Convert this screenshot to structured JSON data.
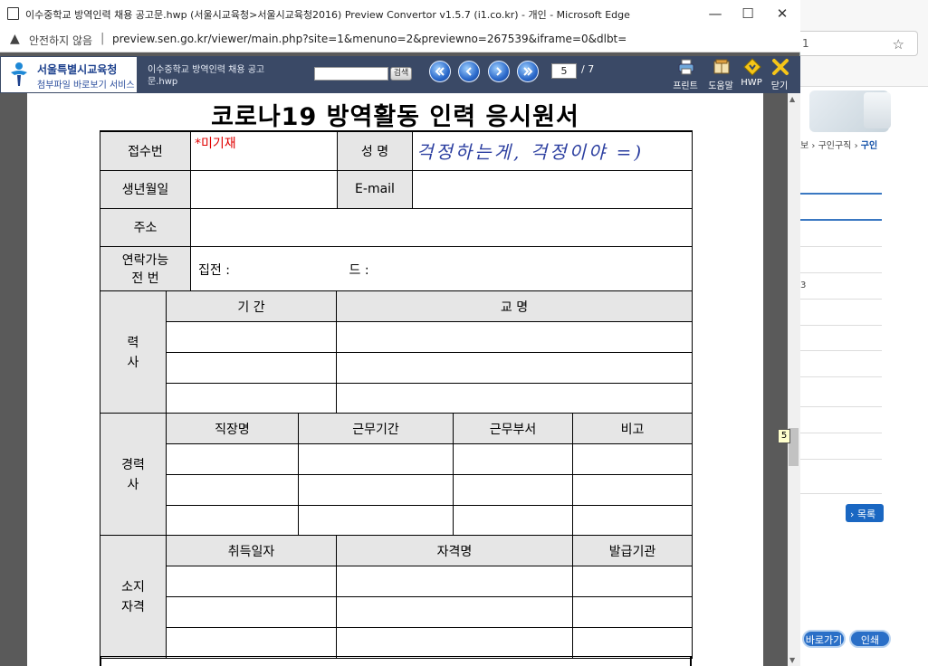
{
  "window": {
    "title": "이수중학교 방역인력 채용 공고문.hwp (서울시교육청>서울시교육청2016) Preview Convertor v1.5.7 (i1.co.kr) - 개인 - Microsoft Edge",
    "minimize": "—",
    "maximize": "☐",
    "close": "✕"
  },
  "address_bar": {
    "security_text": "안전하지 않음",
    "separator": "|",
    "url": "preview.sen.go.kr/viewer/main.php?site=1&menuno=2&previewno=267539&iframe=0&dlbt="
  },
  "viewer_toolbar": {
    "org_name": "서울특별시교육청",
    "org_sub": "첨부파일 바로보기 서비스",
    "doc_title": "이수중학교 방역인력 채용 공고문.hwp",
    "search_placeholder": "",
    "search_label": "검색",
    "current_page": "5",
    "total_pages": "/ 7",
    "tools": [
      {
        "label": "프린트",
        "icon": "printer-icon"
      },
      {
        "label": "도움말",
        "icon": "help-book-icon"
      },
      {
        "label": "HWP",
        "icon": "hwp-download-icon"
      },
      {
        "label": "닫기",
        "icon": "close-x-icon"
      }
    ],
    "accent_color": "#3a4966"
  },
  "page_tooltip": "5",
  "form": {
    "title": "코로나19 방역활동 인력 응시원서",
    "receipt_no_label": "접수번",
    "receipt_no_value": "*미기재",
    "name_label": "성   명",
    "name_value": "걱정하는게, 걱정이야 =)",
    "birth_label": "생년월일",
    "email_label": "E-mail",
    "address_label": "주소",
    "contact_label_1": "연락가능",
    "contact_label_2": "전   번",
    "home_phone_label": "집전   :",
    "mobile_label": "드   :",
    "education_label_1": "력",
    "education_label_2": "사",
    "education_headers": [
      "기      간",
      "교  명"
    ],
    "career_label_1": "경력",
    "career_label_2": "사",
    "career_headers": [
      "직장명",
      "근무기간",
      "근무부서",
      "비고"
    ],
    "cert_label_1": "소지",
    "cert_label_2": "자격",
    "cert_headers": [
      "취득일자",
      "자격명",
      "발급기관"
    ]
  },
  "background_page": {
    "addr_fragment": "1",
    "breadcrumb_prev": "보",
    "breadcrumb_mid": "구인구직",
    "breadcrumb_cur": "구인",
    "number_fragment": "3",
    "list_button": "› 목록",
    "shortcut_button": "바로가기",
    "print_button": "인쇄"
  }
}
